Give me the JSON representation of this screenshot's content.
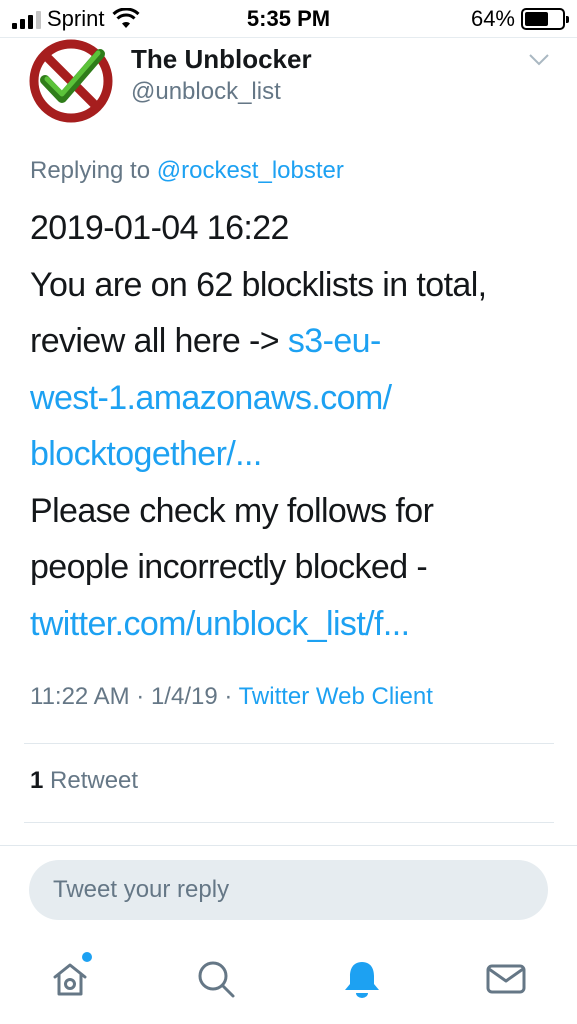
{
  "status_bar": {
    "carrier": "Sprint",
    "time": "5:35 PM",
    "battery_percent": "64%",
    "battery_level": 0.64
  },
  "tweet": {
    "author_name": "The Unblocker",
    "author_handle": "@unblock_list",
    "replying_prefix": "Replying to",
    "replying_to": "@rockest_lobster",
    "lines": [
      {
        "text": "2019-01-04 16:22",
        "link": ""
      },
      {
        "text": " You are on 62 blocklists in total,",
        "link": ""
      },
      {
        "text": "review all here -> ",
        "link": "s3-eu-"
      },
      {
        "text": "",
        "link": "west-1.amazonaws.com/"
      },
      {
        "text": "",
        "link": "blocktogether/..."
      },
      {
        "text": "Please check my follows for",
        "link": ""
      },
      {
        "text": "people incorrectly blocked -",
        "link": ""
      },
      {
        "text": "",
        "link": "twitter.com/unblock_list/f..."
      }
    ],
    "timestamp": "11:22 AM · 1/4/19 · ",
    "client": "Twitter Web Client",
    "retweet_count": "1",
    "retweet_label": " Retweet"
  },
  "reply": {
    "placeholder": "Tweet your reply"
  },
  "tabbar": {
    "items": [
      {
        "icon": "home-icon",
        "active": false,
        "has_notification_dot": true
      },
      {
        "icon": "search-icon",
        "active": false
      },
      {
        "icon": "notifications-bell-icon",
        "active": true
      },
      {
        "icon": "messages-envelope-icon",
        "active": false
      }
    ]
  },
  "colors": {
    "accent": "#1da1f2",
    "secondary_text": "#657786",
    "primary_text": "#14171a"
  }
}
